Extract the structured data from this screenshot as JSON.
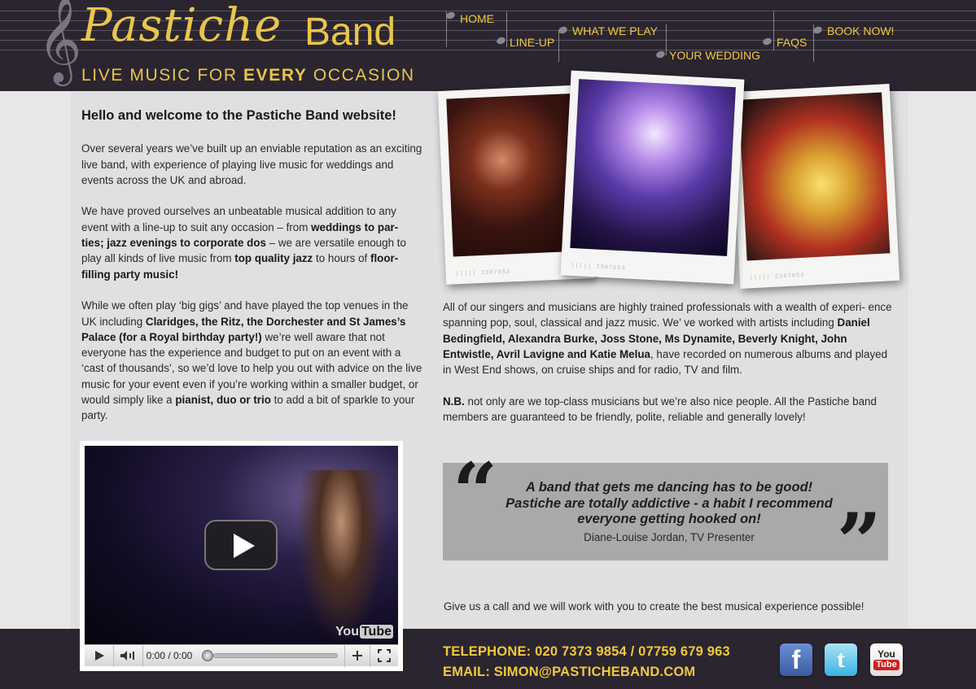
{
  "header": {
    "logo_script": "Pastiche",
    "logo_band": "Band",
    "tagline_pre": "LIVE MUSIC FOR ",
    "tagline_bold": "EVERY",
    "tagline_post": " OCCASION",
    "clef_glyph": "𝄞"
  },
  "nav": {
    "home": "HOME",
    "lineup": "LINE-UP",
    "what_we_play": "WHAT WE PLAY",
    "your_wedding": "YOUR WEDDING",
    "faqs": "FAQS",
    "book_now": "BOOK NOW!"
  },
  "intro": {
    "heading": "Hello and welcome to the Pastiche Band website!",
    "p1": "Over several years we’ve built up an enviable reputation as an exciting live band, with experience of playing live music for weddings and events across the UK and abroad.",
    "p2_a": "We have proved ourselves an unbeatable musical addition to any event with a line-up to suit any occasion – from ",
    "p2_b": "weddings to par- ties; jazz evenings to corporate dos",
    "p2_c": " – we are versatile enough to play all kinds of live music from ",
    "p2_d": "top quality jazz",
    "p2_e": " to hours of ",
    "p2_f": "floor- filling party music!",
    "p3_a": "While we often play ‘big gigs’ and have played the top venues in the UK including ",
    "p3_b": "Claridges, the Ritz, the Dorchester and St James’s Palace (for a Royal birthday party!)",
    "p3_c": " we’re well aware that not everyone has the experience and budget to put on an event with a ‘cast of thousands’, so we’d love to help you out with advice on the live music for your event even if you’re working within a smaller budget, or would simply like a ",
    "p3_d": "pianist, duo or trio",
    "p3_e": " to add a bit of sparkle to your party."
  },
  "about": {
    "p1_a": "All of our singers and musicians are highly trained professionals with a wealth of experi- ence spanning pop, soul, classical and jazz music. We’ ve worked with artists including ",
    "p1_b": "Daniel Bedingfield, Alexandra Burke, Joss Stone, Ms Dynamite, Beverly Knight, John Entwistle, Avril Lavigne and Katie Melua",
    "p1_c": ", have recorded on numerous albums and played in West End shows, on cruise ships and for radio, TV and film.",
    "p2_a": "N.B.",
    "p2_b": " not only are we top-class musicians but we’re also nice people. All the Pastiche band members are guaranteed to be friendly, polite, reliable and generally lovely!"
  },
  "quote": {
    "open": "“",
    "close": "”",
    "text": "A band that gets me dancing has to be good! Pastiche are totally addictive - a habit I recommend everyone getting hooked on!",
    "author": "Diane-Louise Jordan, TV Presenter"
  },
  "cta": "Give us a call and we will work with you to create the best musical experience possible!",
  "video": {
    "time": "0:00 / 0:00",
    "brand_a": "You",
    "brand_b": "Tube",
    "progress": 0
  },
  "contact": {
    "telephone": "TELEPHONE: 020 7373 9854 / 07759 679 963",
    "email": "EMAIL: SIMON@PASTICHEBAND.COM"
  },
  "social": {
    "facebook_glyph": "f",
    "twitter_glyph": "t",
    "youtube_top": "You",
    "youtube_bottom": "Tube"
  },
  "colors": {
    "header_bg": "#2b2530",
    "accent_gold": "#f0c93a",
    "panel_bg": "#e0dfe1",
    "quote_bg": "#a9a8ab"
  },
  "photos": {
    "caption": "||||| 2387653"
  }
}
